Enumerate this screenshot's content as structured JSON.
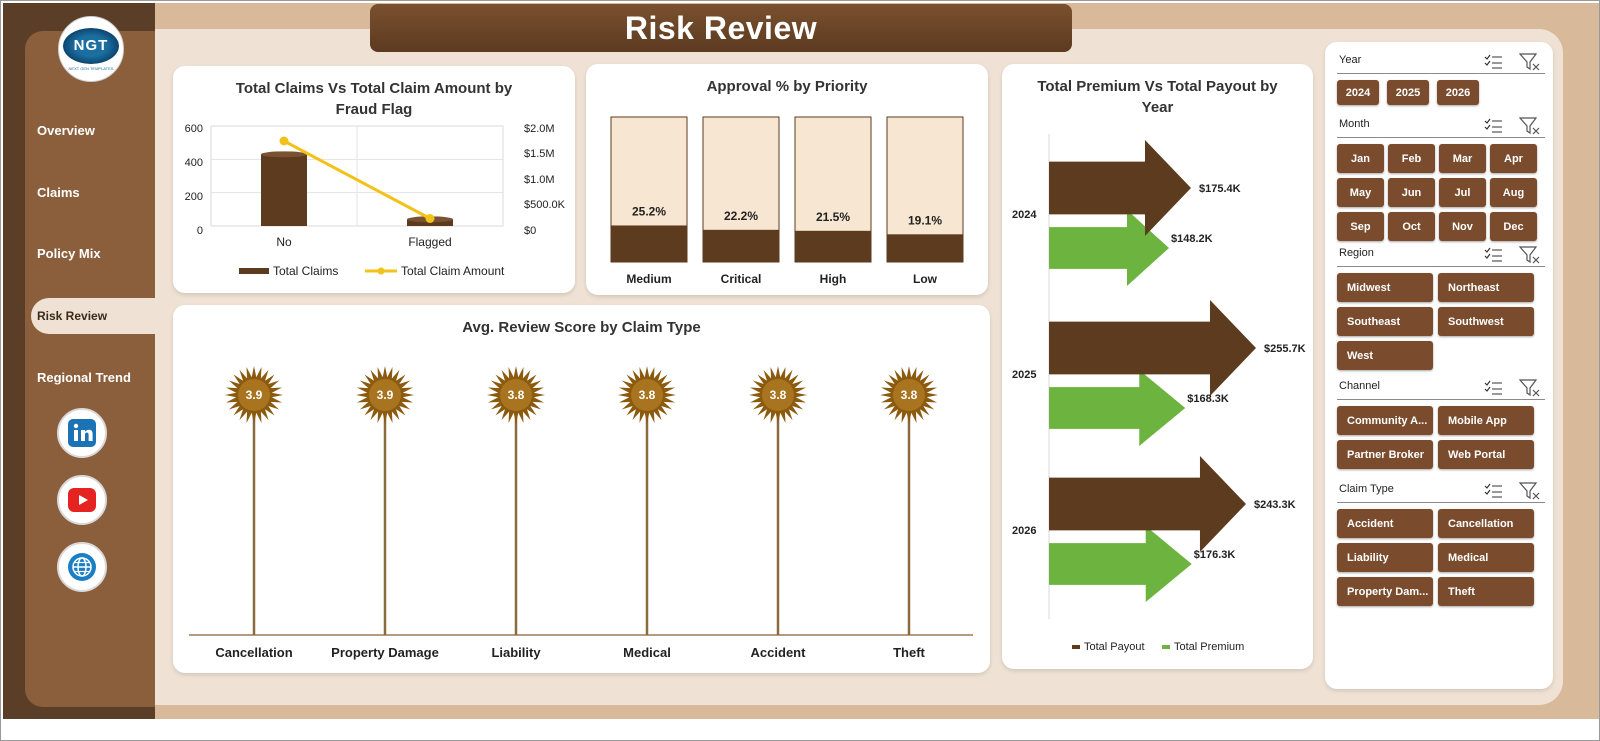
{
  "header": {
    "title": "Risk Review"
  },
  "logo": {
    "text": "NGT",
    "subtext": "NEXT GEN TEMPLATES"
  },
  "nav": {
    "items": [
      "Overview",
      "Claims",
      "Policy Mix",
      "Risk Review",
      "Regional Trend"
    ],
    "active": "Risk Review"
  },
  "social": [
    "linkedin-icon",
    "youtube-icon",
    "globe-icon"
  ],
  "colors": {
    "brown": "#5c3b1e",
    "green": "#6db33f",
    "gold": "#f2c21b",
    "bar_bg": "#f7e6d1",
    "slicer_btn": "#7a4b2c"
  },
  "chart1": {
    "title": "Total Claims Vs Total Claim Amount by Fraud Flag",
    "left_ticks": [
      "600",
      "400",
      "200",
      "0"
    ],
    "right_ticks": [
      "$2.0M",
      "$1.5M",
      "$1.0M",
      "$500.0K",
      "$0"
    ],
    "legend": [
      "Total Claims",
      "Total Claim Amount"
    ]
  },
  "chart2": {
    "title": "Approval % by Priority"
  },
  "chart3": {
    "title": "Avg. Review Score by Claim Type",
    "value_labels": [
      "3.9",
      "3.9",
      "3.8",
      "3.8",
      "3.8",
      "3.8"
    ]
  },
  "chart4": {
    "title": "Total Premium Vs Total Payout by Year",
    "legend": [
      "Total Payout",
      "Total Premium"
    ],
    "payout_labels": [
      "$175.4K",
      "$255.7K",
      "$243.3K"
    ],
    "premium_labels": [
      "$148.2K",
      "$168.3K",
      "$176.3K"
    ]
  },
  "chart_data": [
    {
      "type": "bar",
      "title": "Total Claims Vs Total Claim Amount by Fraud Flag",
      "categories": [
        "No",
        "Flagged"
      ],
      "series": [
        {
          "name": "Total Claims",
          "values": [
            430,
            40
          ],
          "axis": "left"
        },
        {
          "name": "Total Claim Amount",
          "values": [
            1700000,
            150000
          ],
          "axis": "right",
          "render": "line"
        }
      ],
      "ylim_left": [
        0,
        600
      ],
      "ylim_right": [
        0,
        2000000
      ],
      "legend_position": "bottom"
    },
    {
      "type": "bar",
      "title": "Approval % by Priority",
      "categories": [
        "Medium",
        "Critical",
        "High",
        "Low"
      ],
      "values": [
        25.2,
        22.2,
        21.5,
        19.1
      ],
      "labels": [
        "25.2%",
        "22.2%",
        "21.5%",
        "19.1%"
      ],
      "ylim": [
        0,
        100
      ]
    },
    {
      "type": "scatter",
      "title": "Avg. Review Score by Claim Type",
      "categories": [
        "Cancellation",
        "Property Damage",
        "Liability",
        "Medical",
        "Accident",
        "Theft"
      ],
      "values": [
        3.9,
        3.9,
        3.8,
        3.8,
        3.8,
        3.8
      ]
    },
    {
      "type": "bar",
      "title": "Total Premium Vs Total Payout by Year",
      "categories": [
        "2024",
        "2025",
        "2026"
      ],
      "series": [
        {
          "name": "Total Payout",
          "values": [
            175.4,
            255.7,
            243.3
          ]
        },
        {
          "name": "Total Premium",
          "values": [
            148.2,
            168.3,
            176.3
          ]
        }
      ],
      "unit": "$K",
      "orientation": "horizontal",
      "legend_position": "bottom"
    }
  ],
  "slicers": [
    {
      "name": "Year",
      "items": [
        "2024",
        "2025",
        "2026"
      ]
    },
    {
      "name": "Month",
      "items": [
        "Jan",
        "Feb",
        "Mar",
        "Apr",
        "May",
        "Jun",
        "Jul",
        "Aug",
        "Sep",
        "Oct",
        "Nov",
        "Dec"
      ]
    },
    {
      "name": "Region",
      "items": [
        "Midwest",
        "Northeast",
        "Southeast",
        "Southwest",
        "West"
      ]
    },
    {
      "name": "Channel",
      "items": [
        "Community A...",
        "Mobile App",
        "Partner Broker",
        "Web Portal"
      ]
    },
    {
      "name": "Claim Type",
      "items": [
        "Accident",
        "Cancellation",
        "Liability",
        "Medical",
        "Property Dam...",
        "Theft"
      ]
    }
  ]
}
